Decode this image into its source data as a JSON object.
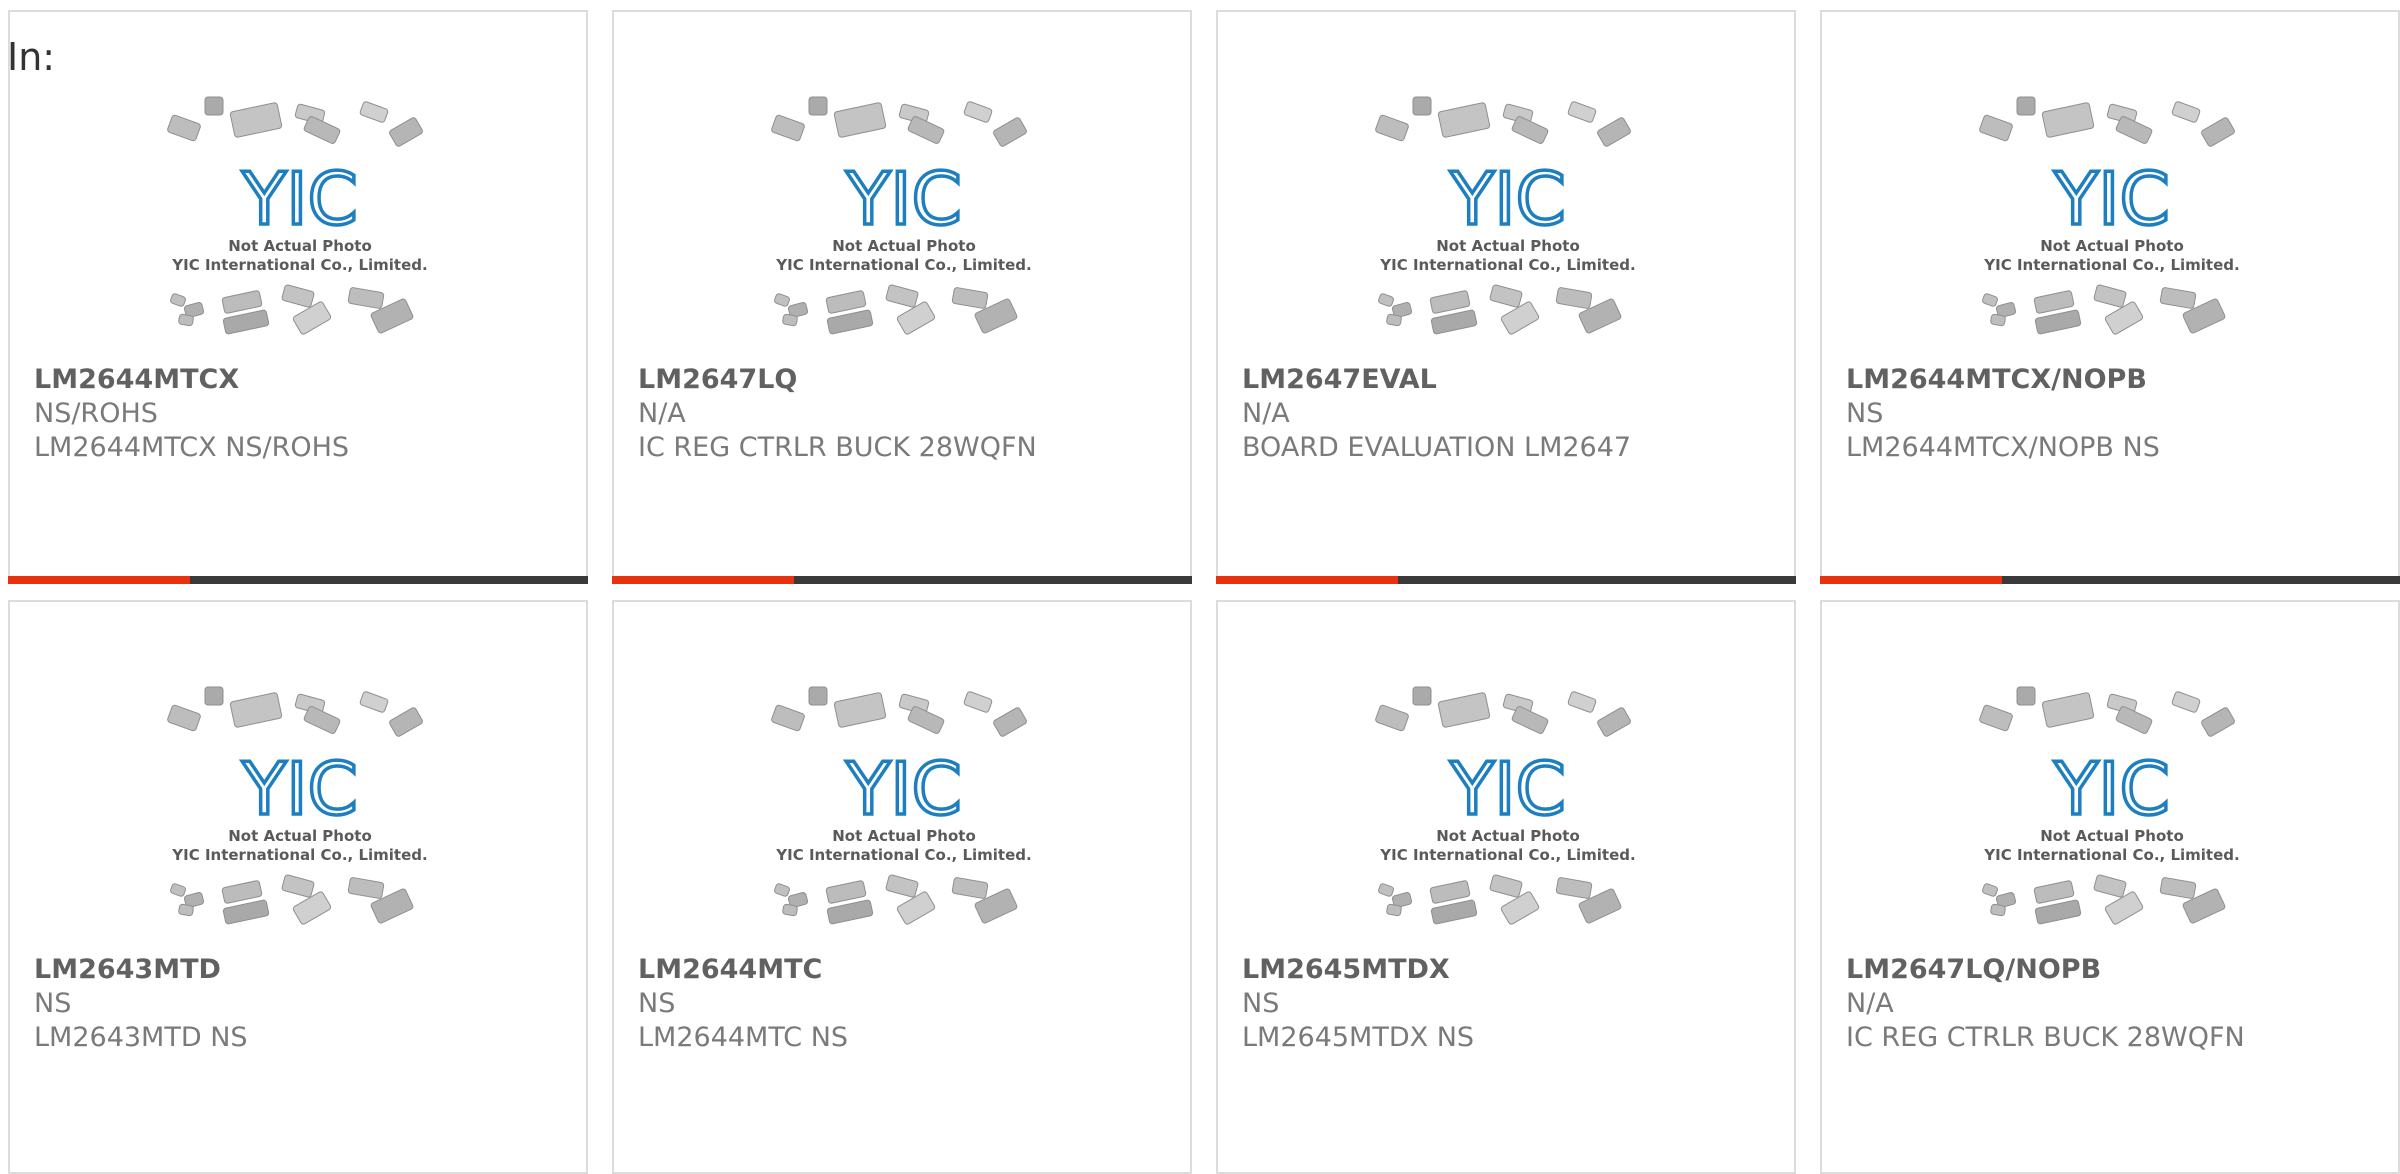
{
  "page": {
    "label": "In:"
  },
  "photo": {
    "caption_line1": "Not Actual Photo",
    "caption_line2": "YIC International Co., Limited.",
    "logo_text": "YIC",
    "logo_color": "#1e7fc0"
  },
  "colors": {
    "accent": "#e8320f",
    "bar": "#3a3a3a",
    "border": "#dcdcdc"
  },
  "products": [
    {
      "part": "LM2644MTCX",
      "brand": "NS/ROHS",
      "description": "LM2644MTCX NS/ROHS"
    },
    {
      "part": "LM2647LQ",
      "brand": "N/A",
      "description": "IC REG CTRLR BUCK 28WQFN"
    },
    {
      "part": "LM2647EVAL",
      "brand": "N/A",
      "description": "BOARD EVALUATION LM2647"
    },
    {
      "part": "LM2644MTCX/NOPB",
      "brand": "NS",
      "description": "LM2644MTCX/NOPB NS"
    },
    {
      "part": "LM2643MTD",
      "brand": "NS",
      "description": "LM2643MTD NS"
    },
    {
      "part": "LM2644MTC",
      "brand": "NS",
      "description": "LM2644MTC NS"
    },
    {
      "part": "LM2645MTDX",
      "brand": "NS",
      "description": "LM2645MTDX NS"
    },
    {
      "part": "LM2647LQ/NOPB",
      "brand": "N/A",
      "description": "IC REG CTRLR BUCK 28WQFN"
    }
  ]
}
